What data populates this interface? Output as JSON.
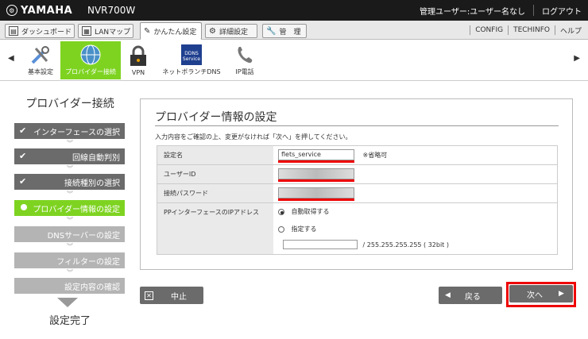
{
  "header": {
    "brand": "YAMAHA",
    "model": "NVR700W",
    "user_text": "管理ユーザー:ユーザー名なし",
    "logout": "ログアウト"
  },
  "tabs": [
    {
      "label": "ダッシュボード",
      "icon": "dashboard-icon"
    },
    {
      "label": "LANマップ",
      "icon": "lanmap-icon"
    },
    {
      "label": "かんたん設定",
      "icon": "wizard-icon",
      "active": true
    },
    {
      "label": "詳細設定",
      "icon": "gear-icon"
    },
    {
      "label": "管　理",
      "icon": "wrench-icon"
    }
  ],
  "tabbar_right": {
    "config": "CONFIG",
    "techinfo": "TECHINFO",
    "help": "ヘルプ"
  },
  "icon_nav": [
    {
      "label": "基本設定",
      "icon": "tools-icon"
    },
    {
      "label": "プロバイダー接続",
      "icon": "globe-icon",
      "active": true
    },
    {
      "label": "VPN",
      "icon": "lock-icon"
    },
    {
      "label": "ネットボランチDNS",
      "icon": "ddns-icon",
      "badge": "DDNS Service"
    },
    {
      "label": "IP電話",
      "icon": "phone-icon"
    }
  ],
  "sidebar": {
    "title": "プロバイダー接続",
    "steps": [
      {
        "label": "インターフェースの選択",
        "state": "done"
      },
      {
        "label": "回線自動判別",
        "state": "done"
      },
      {
        "label": "接続種別の選択",
        "state": "done"
      },
      {
        "label": "プロバイダー情報の設定",
        "state": "current"
      },
      {
        "label": "DNSサーバーの設定",
        "state": "todo"
      },
      {
        "label": "フィルターの設定",
        "state": "todo"
      },
      {
        "label": "設定内容の確認",
        "state": "todo"
      }
    ],
    "final": "設定完了"
  },
  "panel": {
    "title": "プロバイダー情報の設定",
    "description": "入力内容をご確認の上、変更がなければ「次へ」を押してください。",
    "fields": {
      "name_label": "設定名",
      "name_value": "flets_service",
      "name_note": "※省略可",
      "user_label": "ユーザーID",
      "pass_label": "接続パスワード",
      "ip_label": "PPインターフェースのIPアドレス",
      "auto_label": "自動取得する",
      "manual_label": "指定する",
      "mask_text": "/ 255.255.255.255 ( 32bit )"
    }
  },
  "buttons": {
    "cancel": "中止",
    "back": "戻る",
    "next": "次へ"
  },
  "colors": {
    "accent_green": "#7ed321",
    "highlight_red": "#e00000"
  }
}
